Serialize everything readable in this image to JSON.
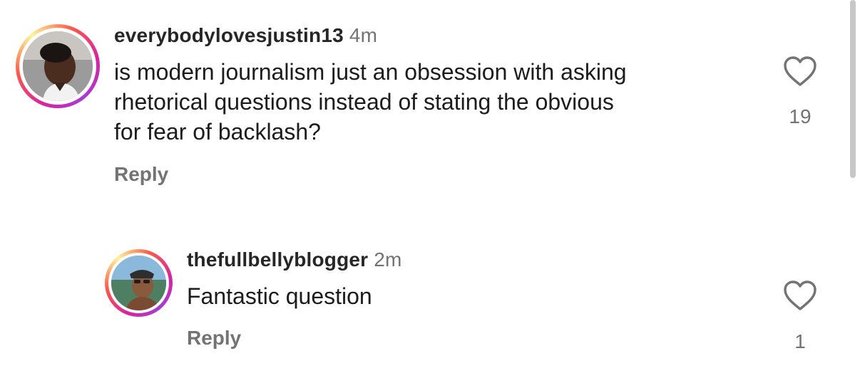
{
  "comments": [
    {
      "username": "everybodylovesjustin13",
      "time": "4m",
      "text_lines": [
        "is modern journalism just an obsession with asking",
        "rhetorical questions instead of stating the obvious",
        "for fear of backlash?"
      ],
      "reply_label": "Reply",
      "likes": "19",
      "avatar_icon": "user-avatar",
      "heart_icon": "heart-outline-icon"
    },
    {
      "username": "thefullbellyblogger",
      "time": "2m",
      "text_lines": [
        "Fantastic question"
      ],
      "reply_label": "Reply",
      "likes": "1",
      "avatar_icon": "user-avatar",
      "heart_icon": "heart-outline-icon"
    }
  ],
  "colors": {
    "text": "#1c1c1c",
    "muted": "#737373",
    "ring_gradient": [
      "#d6249f",
      "#fd5949",
      "#fdf497"
    ]
  }
}
